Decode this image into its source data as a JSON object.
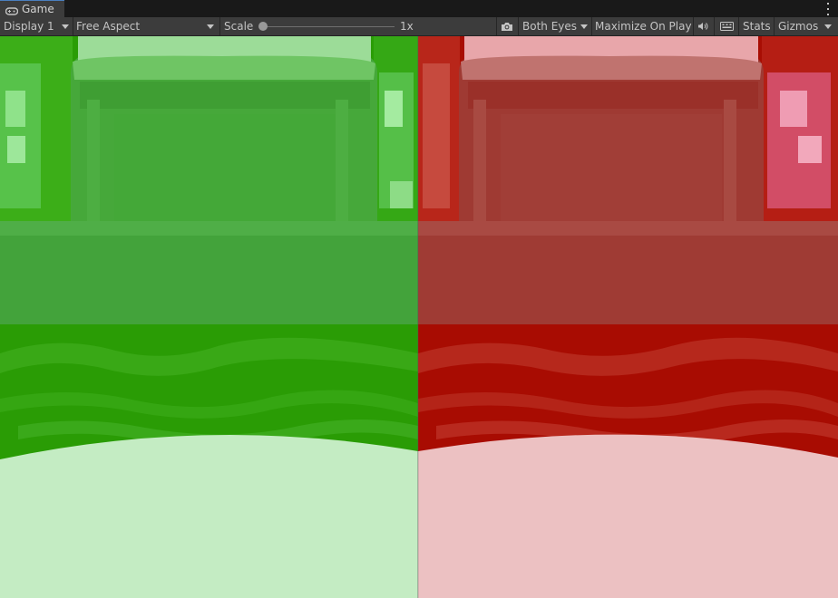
{
  "window": {
    "tab_title": "Game"
  },
  "toolbar": {
    "display": "Display 1",
    "aspect": "Free Aspect",
    "scale_label": "Scale",
    "scale_value": "1x",
    "eyes": "Both Eyes",
    "maximize": "Maximize On Play",
    "stats": "Stats",
    "gizmos": "Gizmos"
  },
  "icons": [
    "gamepad-icon",
    "camera-icon",
    "audio-icon",
    "keyboard-icon",
    "kebab-menu-icon",
    "dropdown-arrow-icon"
  ],
  "viewport": {
    "left_eye_tint": "#22aa00",
    "right_eye_tint": "#aa1100"
  }
}
